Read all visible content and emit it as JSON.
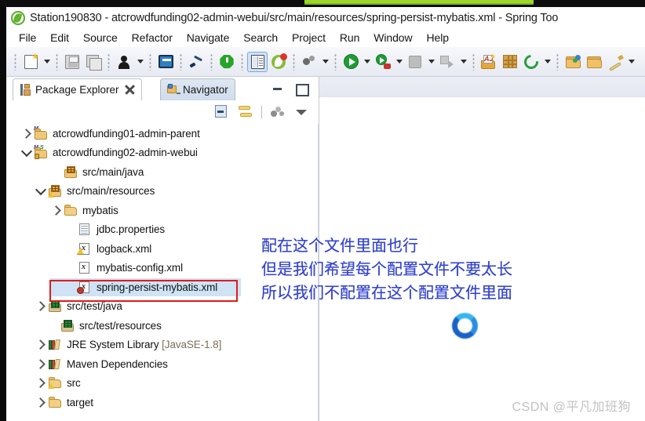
{
  "window": {
    "title": "Station190830 - atcrowdfunding02-admin-webui/src/main/resources/spring-persist-mybatis.xml - Spring Too",
    "app_icon": "spring-leaf-icon",
    "accent_green": "#9ed62a"
  },
  "menubar": {
    "items": [
      {
        "label": "File"
      },
      {
        "label": "Edit"
      },
      {
        "label": "Source"
      },
      {
        "label": "Refactor"
      },
      {
        "label": "Navigate"
      },
      {
        "label": "Search"
      },
      {
        "label": "Project"
      },
      {
        "label": "Run"
      },
      {
        "label": "Window"
      },
      {
        "label": "Help"
      }
    ]
  },
  "toolbar": {
    "buttons": [
      {
        "name": "new-wizard-button",
        "icon": "new-file-icon"
      },
      {
        "name": "new-wizard-dropdown",
        "icon": "chevron-down-icon"
      },
      {
        "name": "save-button",
        "icon": "save-icon"
      },
      {
        "name": "save-all-button",
        "icon": "save-all-icon"
      },
      {
        "name": "user-button",
        "icon": "person-icon"
      },
      {
        "name": "user-dropdown",
        "icon": "chevron-down-icon"
      },
      {
        "name": "console-button",
        "icon": "monitor-icon"
      },
      {
        "name": "skip-breakpoints-button",
        "icon": "pen-strike-icon"
      },
      {
        "name": "terminate-button",
        "icon": "green-hex-icon"
      },
      {
        "name": "open-task-button",
        "icon": "book-icon"
      },
      {
        "name": "spring-boot-dashboard-button",
        "icon": "spring-badge-icon"
      },
      {
        "name": "debug-tools-button",
        "icon": "debug-dots-icon"
      },
      {
        "name": "debug-tools-dropdown",
        "icon": "chevron-down-icon"
      },
      {
        "name": "run-button",
        "icon": "run-play-icon"
      },
      {
        "name": "run-dropdown",
        "icon": "chevron-down-icon"
      },
      {
        "name": "debug-button",
        "icon": "debug-bug-icon"
      },
      {
        "name": "debug-dropdown",
        "icon": "chevron-down-icon"
      },
      {
        "name": "stop-button",
        "icon": "stop-square-icon"
      },
      {
        "name": "stop-dropdown",
        "icon": "chevron-down-icon"
      },
      {
        "name": "step-over-button",
        "icon": "step-over-icon"
      },
      {
        "name": "step-over-dropdown",
        "icon": "chevron-down-icon"
      },
      {
        "name": "new-aspectj-project-button",
        "icon": "aspectj-folder-icon"
      },
      {
        "name": "new-package-button",
        "icon": "package-grid-icon"
      },
      {
        "name": "new-class-button",
        "icon": "green-circle-new-icon"
      },
      {
        "name": "new-class-dropdown",
        "icon": "chevron-down-icon"
      },
      {
        "name": "open-type-button",
        "icon": "open-folder-ball-icon"
      },
      {
        "name": "open-resource-button",
        "icon": "open-folder-icon"
      },
      {
        "name": "quick-access-button",
        "icon": "brush-icon"
      },
      {
        "name": "quick-access-dropdown",
        "icon": "chevron-down-icon"
      }
    ]
  },
  "view_tabs": {
    "selected": {
      "label": "Package Explorer",
      "icon": "package-explorer-icon",
      "close_icon": "close-icon"
    },
    "unselected": {
      "label": "Navigator",
      "icon": "navigator-icon"
    },
    "minimize_label": "Minimize",
    "maximize_label": "Maximize"
  },
  "view_toolbar": {
    "buttons": [
      {
        "name": "collapse-all-button",
        "icon": "collapse-all-icon"
      },
      {
        "name": "link-with-editor-button",
        "icon": "link-editor-icon"
      },
      {
        "name": "view-menu-dots-button",
        "icon": "view-presentation-icon"
      },
      {
        "name": "view-menu-button",
        "icon": "chevron-down-icon"
      }
    ]
  },
  "tree": {
    "nodes": [
      {
        "label": "atcrowdfunding01-admin-parent",
        "indent": 0,
        "twisty": "collapsed",
        "icon": "maven-project-icon",
        "selected": false
      },
      {
        "label": "atcrowdfunding02-admin-webui",
        "indent": 0,
        "twisty": "expanded",
        "icon": "maven-project-icon",
        "selected": false
      },
      {
        "label": "src/main/java",
        "indent": 1,
        "twisty": "none",
        "icon": "source-folder-icon",
        "selected": false
      },
      {
        "label": "src/main/resources",
        "indent": 1,
        "twisty": "expanded",
        "icon": "source-folder-warning-icon",
        "selected": false
      },
      {
        "label": "mybatis",
        "indent": 2,
        "twisty": "collapsed",
        "icon": "folder-icon",
        "selected": false
      },
      {
        "label": "jdbc.properties",
        "indent": 2,
        "twisty": "none",
        "icon": "properties-file-icon",
        "selected": false
      },
      {
        "label": "logback.xml",
        "indent": 2,
        "twisty": "none",
        "icon": "xml-file-warning-icon",
        "selected": false
      },
      {
        "label": "mybatis-config.xml",
        "indent": 2,
        "twisty": "none",
        "icon": "xml-file-icon",
        "selected": false
      },
      {
        "label": "spring-persist-mybatis.xml",
        "indent": 2,
        "twisty": "none",
        "icon": "xml-file-error-icon",
        "selected": true
      },
      {
        "label": "src/test/java",
        "indent": 1,
        "twisty": "collapsed",
        "icon": "test-source-folder-icon",
        "selected": false
      },
      {
        "label": "src/test/resources",
        "indent": 1,
        "twisty": "none",
        "icon": "test-source-folder-icon",
        "selected": false
      },
      {
        "label": "JRE System Library ",
        "suffix": "[JavaSE-1.8]",
        "indent": 1,
        "twisty": "collapsed",
        "icon": "library-icon",
        "selected": false
      },
      {
        "label": "Maven Dependencies",
        "indent": 1,
        "twisty": "collapsed",
        "icon": "library-icon",
        "selected": false
      },
      {
        "label": "src",
        "indent": 1,
        "twisty": "collapsed",
        "icon": "folder-warning-icon",
        "selected": false
      },
      {
        "label": "target",
        "indent": 1,
        "twisty": "collapsed",
        "icon": "folder-icon",
        "selected": false
      }
    ]
  },
  "annotation": {
    "color": "#3344cc",
    "lines": [
      "配在这个文件里面也行",
      "但是我们希望每个配置文件不要太长",
      "所以我们不配置在这个配置文件里面"
    ],
    "highlight_box_color": "#e01b1b",
    "highlight_target": "spring-persist-mybatis.xml"
  },
  "spinner": {
    "name": "loading-spinner",
    "color": "#1763c8"
  },
  "watermark": {
    "text": "CSDN @平凡加班狗"
  }
}
